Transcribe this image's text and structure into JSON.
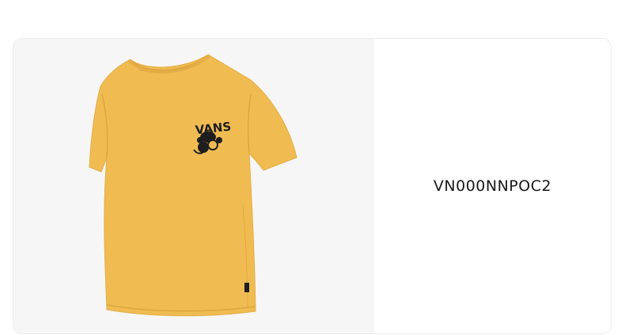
{
  "product": {
    "code": "VN000NNPOC2",
    "image_alt": "Yellow short-sleeve t-shirt",
    "print_text": "VANS"
  },
  "colors": {
    "shirt": "#f0bc52",
    "shirt_shadow": "#dea63e",
    "panel_bg": "#f6f6f6",
    "ink": "#1e1e1e"
  }
}
